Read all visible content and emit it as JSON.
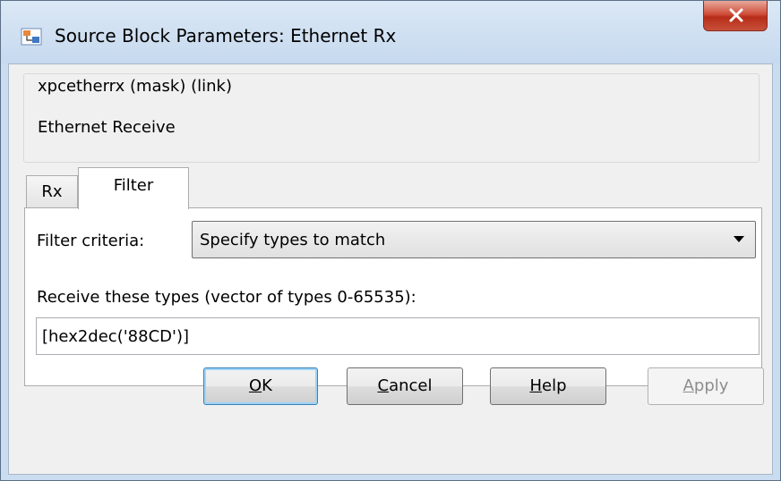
{
  "window": {
    "title": "Source Block Parameters: Ethernet Rx",
    "close_glyph": "X"
  },
  "mask": {
    "title": "xpcetherrx (mask) (link)",
    "description": "Ethernet Receive"
  },
  "tabs": [
    {
      "label": "Rx",
      "selected": false
    },
    {
      "label": "Filter",
      "selected": true
    }
  ],
  "filter": {
    "criteria_label": "Filter criteria:",
    "criteria_value": "Specify types to match",
    "types_label": "Receive these types (vector of types 0-65535):",
    "types_value": "[hex2dec('88CD')]"
  },
  "buttons": {
    "ok": {
      "mnemonic": "O",
      "rest": "K"
    },
    "cancel": {
      "mnemonic": "C",
      "rest": "ancel"
    },
    "help": {
      "mnemonic": "H",
      "rest": "elp"
    },
    "apply": {
      "mnemonic": "A",
      "rest": "pply",
      "disabled": true
    }
  },
  "colors": {
    "titlebar": "#c6d9ee",
    "close_button": "#c8503b",
    "default_button_border": "#3c7fb1",
    "disabled_text": "#8d8d8d"
  },
  "icons": [
    "simulink-block-icon",
    "close-icon",
    "dropdown-arrow-icon"
  ]
}
